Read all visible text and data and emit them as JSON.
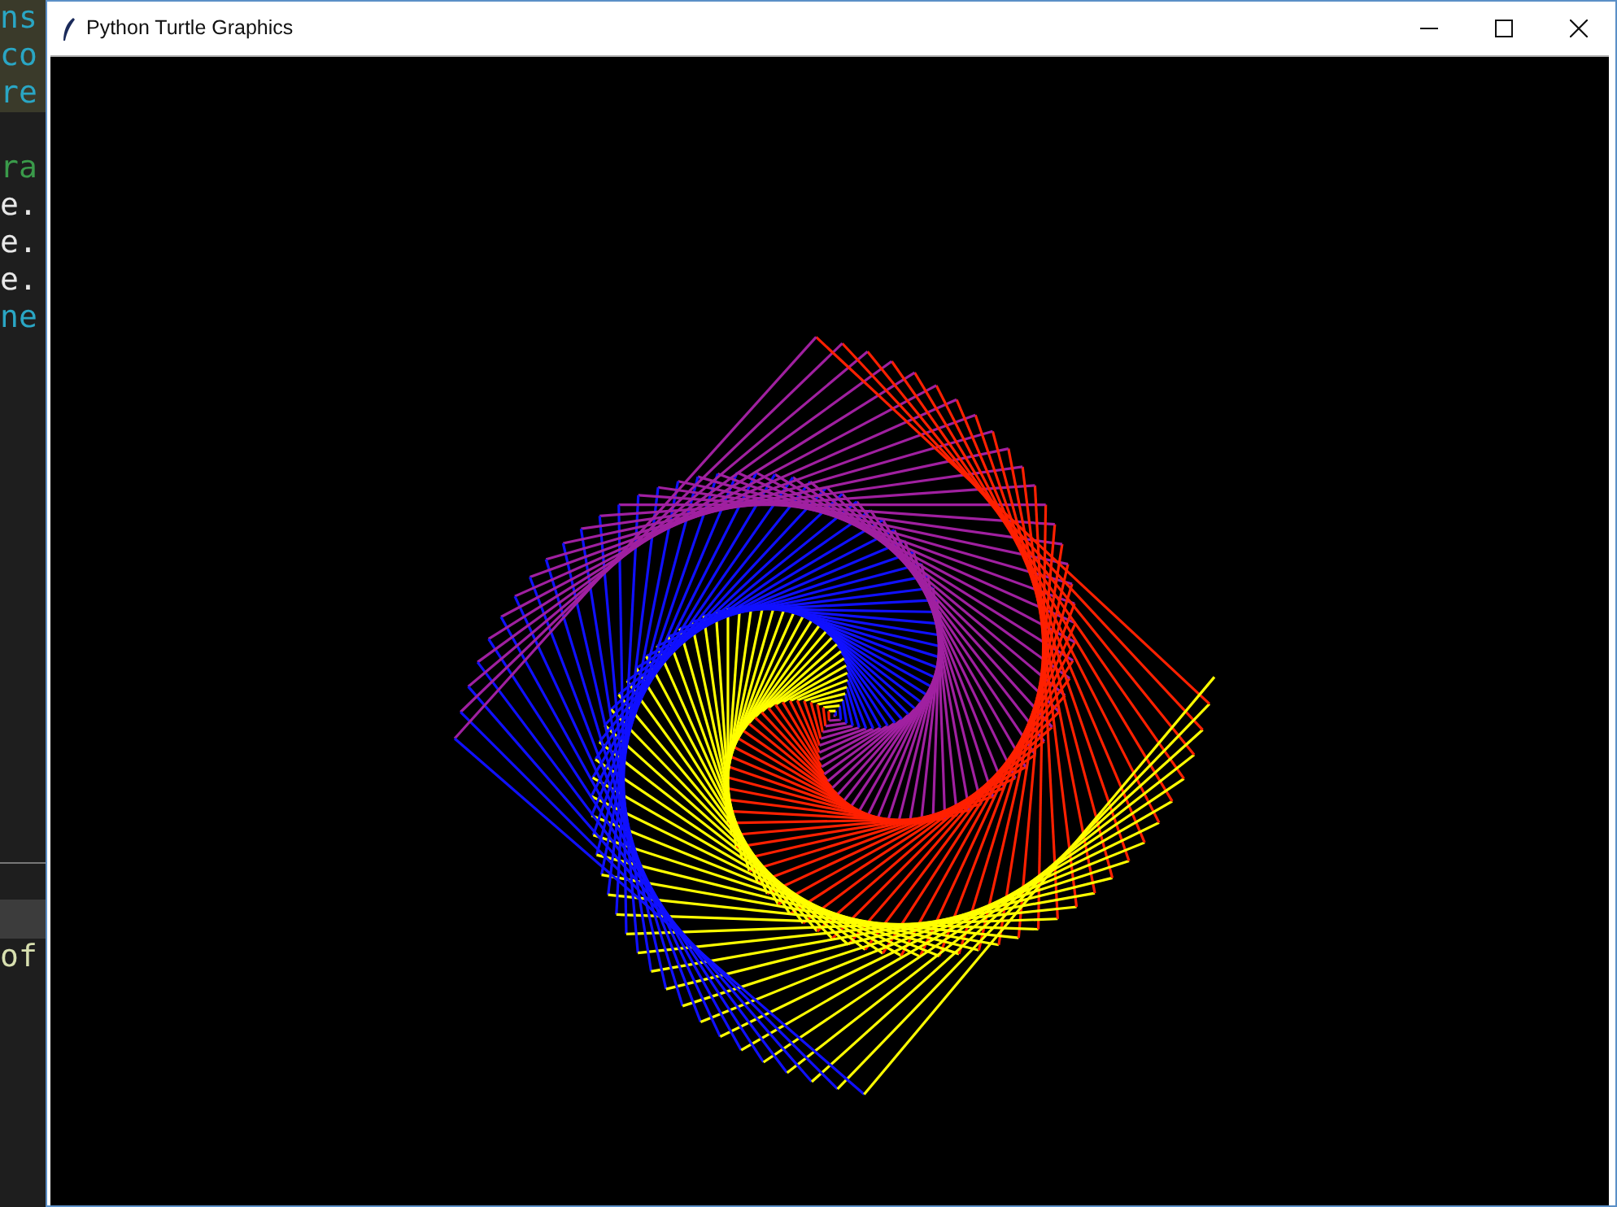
{
  "editor": {
    "code_lines": [
      {
        "text": "ns",
        "kind": "keyword"
      },
      {
        "text": "co",
        "kind": "keyword"
      },
      {
        "text": "re",
        "kind": "keyword"
      },
      {
        "kind": "blank"
      },
      {
        "text": "ra",
        "kind": "builtin"
      },
      {
        "text": "e.",
        "kind": "plain"
      },
      {
        "text": "e.",
        "kind": "plain"
      },
      {
        "text": "e.",
        "kind": "plain"
      },
      {
        "text": "ne",
        "kind": "keyword"
      }
    ],
    "console_line": "of"
  },
  "window": {
    "title": "Python Turtle Graphics"
  }
}
